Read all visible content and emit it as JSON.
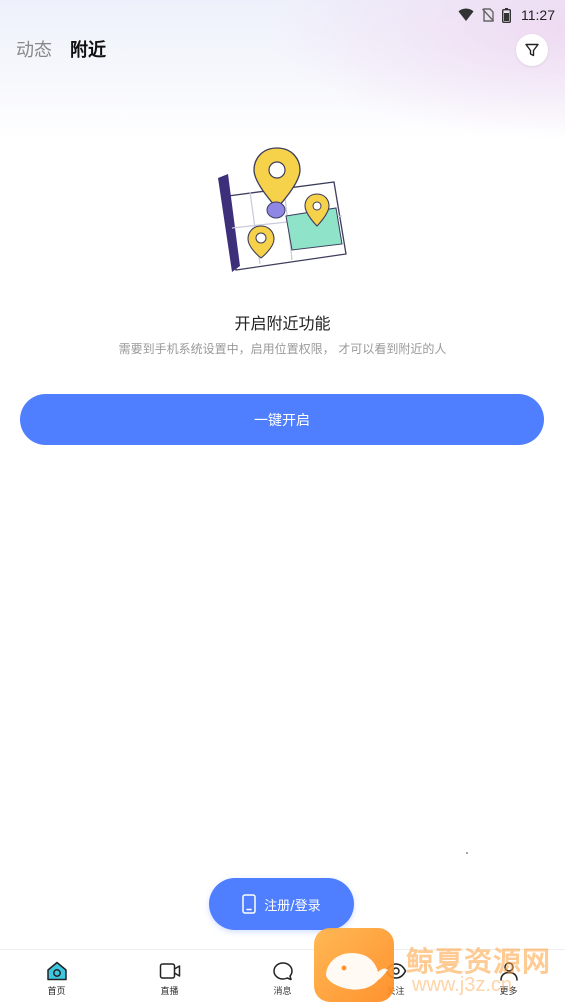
{
  "status_bar": {
    "time": "11:27",
    "icons": [
      "wifi-icon",
      "no-sim-icon",
      "battery-icon"
    ]
  },
  "header": {
    "tabs": [
      {
        "label": "动态",
        "active": false
      },
      {
        "label": "附近",
        "active": true
      }
    ],
    "filter_icon": "filter-icon"
  },
  "empty_state": {
    "title": "开启附近功能",
    "description": "需要到手机系统设置中，启用位置权限， 才可以看到附近的人",
    "button_label": "一键开启"
  },
  "login_button": {
    "label": "注册/登录",
    "icon": "phone-icon"
  },
  "bottom_nav": {
    "items": [
      {
        "label": "首页",
        "icon": "home-icon",
        "active": true
      },
      {
        "label": "直播",
        "icon": "video-icon",
        "active": false
      },
      {
        "label": "消息",
        "icon": "message-icon",
        "active": false
      },
      {
        "label": "关注",
        "icon": "eye-icon",
        "active": false
      },
      {
        "label": "更多",
        "icon": "user-icon",
        "active": false
      }
    ]
  },
  "watermark": {
    "text": "鲸夏资源网",
    "url": "www.j3z.cn"
  },
  "colors": {
    "accent": "#4f7fff",
    "active_nav_icon": "#3ec6e0",
    "map_pin": "#f5d24a",
    "map_green": "#8ee3c8"
  }
}
